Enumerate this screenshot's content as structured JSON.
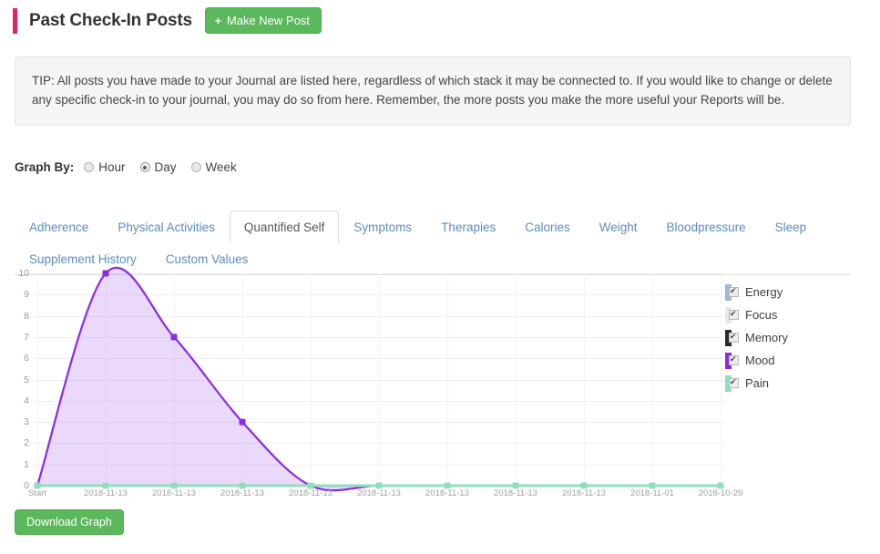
{
  "header": {
    "title": "Past Check-In Posts",
    "make_post_label": "Make New Post",
    "plus_glyph": "+",
    "accent_color": "#e0245e"
  },
  "tip": {
    "text": "TIP: All posts you have made to your Journal are listed here, regardless of which stack it may be connected to. If you would like to change or delete any specific check-in to your journal, you may do so from here. Remember, the more posts you make the more useful your Reports will be."
  },
  "graph_by": {
    "label": "Graph By:",
    "options": [
      {
        "label": "Hour",
        "selected": false
      },
      {
        "label": "Day",
        "selected": true
      },
      {
        "label": "Week",
        "selected": false
      }
    ]
  },
  "tabs": [
    {
      "label": "Adherence",
      "active": false
    },
    {
      "label": "Physical Activities",
      "active": false
    },
    {
      "label": "Quantified Self",
      "active": true
    },
    {
      "label": "Symptoms",
      "active": false
    },
    {
      "label": "Therapies",
      "active": false
    },
    {
      "label": "Calories",
      "active": false
    },
    {
      "label": "Weight",
      "active": false
    },
    {
      "label": "Bloodpressure",
      "active": false
    },
    {
      "label": "Sleep",
      "active": false
    },
    {
      "label": "Supplement History",
      "active": false
    },
    {
      "label": "Custom Values",
      "active": false
    }
  ],
  "legend": [
    {
      "label": "Energy",
      "color": "#9db8d2",
      "checked": true
    },
    {
      "label": "Focus",
      "color": "#e8e8e8",
      "checked": true
    },
    {
      "label": "Memory",
      "color": "#2b2b2b",
      "checked": true
    },
    {
      "label": "Mood",
      "color": "#8a2be2",
      "checked": true
    },
    {
      "label": "Pain",
      "color": "#8fe0bd",
      "checked": true
    }
  ],
  "footer": {
    "download_label": "Download Graph"
  },
  "chart_data": {
    "type": "area",
    "title": "",
    "xlabel": "",
    "ylabel": "",
    "ylim": [
      0,
      10
    ],
    "yticks": [
      0,
      1,
      2,
      3,
      4,
      5,
      6,
      7,
      8,
      9,
      10
    ],
    "grid": true,
    "legend_position": "right",
    "categories": [
      "Start",
      "2018-11-13",
      "2018-11-13",
      "2018-11-13",
      "2018-11-13",
      "2018-11-13",
      "2018-11-13",
      "2018-11-13",
      "2018-11-13",
      "2018-11-01",
      "2018-10-29"
    ],
    "series": [
      {
        "name": "Energy",
        "color": "#9db8d2",
        "values": [
          0,
          0,
          0,
          0,
          0,
          0,
          0,
          0,
          0,
          0,
          0
        ]
      },
      {
        "name": "Focus",
        "color": "#e8e8e8",
        "values": [
          0,
          0,
          0,
          0,
          0,
          0,
          0,
          0,
          0,
          0,
          0
        ]
      },
      {
        "name": "Memory",
        "color": "#2b2b2b",
        "values": [
          0,
          0,
          0,
          0,
          0,
          0,
          0,
          0,
          0,
          0,
          0
        ]
      },
      {
        "name": "Mood",
        "color": "#8a2be2",
        "values": [
          0,
          10,
          7,
          3,
          0,
          0,
          0,
          0,
          0,
          0,
          0
        ]
      },
      {
        "name": "Pain",
        "color": "#8fe0bd",
        "values": [
          0,
          0,
          0,
          0,
          0,
          0,
          0,
          0,
          0,
          0,
          0
        ]
      }
    ]
  }
}
